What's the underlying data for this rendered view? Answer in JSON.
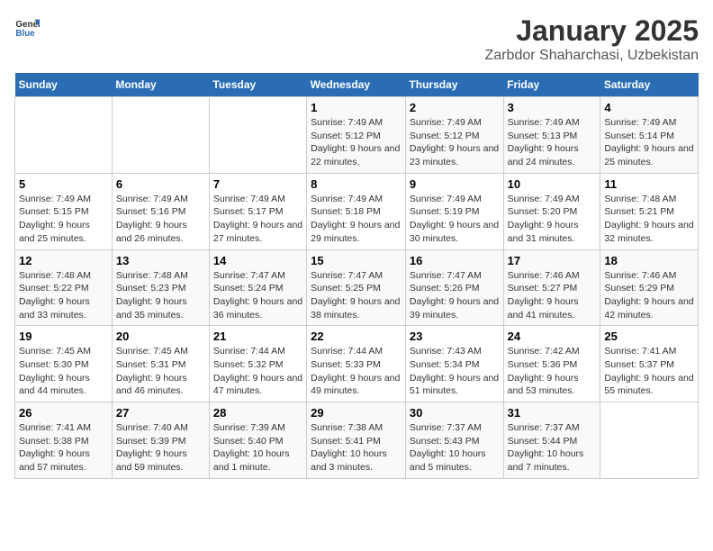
{
  "header": {
    "logo_general": "General",
    "logo_blue": "Blue",
    "title": "January 2025",
    "subtitle": "Zarbdor Shaharchasi, Uzbekistan"
  },
  "days_of_week": [
    "Sunday",
    "Monday",
    "Tuesday",
    "Wednesday",
    "Thursday",
    "Friday",
    "Saturday"
  ],
  "weeks": [
    [
      {
        "day": "",
        "info": ""
      },
      {
        "day": "",
        "info": ""
      },
      {
        "day": "",
        "info": ""
      },
      {
        "day": "1",
        "info": "Sunrise: 7:49 AM\nSunset: 5:12 PM\nDaylight: 9 hours and 22 minutes."
      },
      {
        "day": "2",
        "info": "Sunrise: 7:49 AM\nSunset: 5:12 PM\nDaylight: 9 hours and 23 minutes."
      },
      {
        "day": "3",
        "info": "Sunrise: 7:49 AM\nSunset: 5:13 PM\nDaylight: 9 hours and 24 minutes."
      },
      {
        "day": "4",
        "info": "Sunrise: 7:49 AM\nSunset: 5:14 PM\nDaylight: 9 hours and 25 minutes."
      }
    ],
    [
      {
        "day": "5",
        "info": "Sunrise: 7:49 AM\nSunset: 5:15 PM\nDaylight: 9 hours and 25 minutes."
      },
      {
        "day": "6",
        "info": "Sunrise: 7:49 AM\nSunset: 5:16 PM\nDaylight: 9 hours and 26 minutes."
      },
      {
        "day": "7",
        "info": "Sunrise: 7:49 AM\nSunset: 5:17 PM\nDaylight: 9 hours and 27 minutes."
      },
      {
        "day": "8",
        "info": "Sunrise: 7:49 AM\nSunset: 5:18 PM\nDaylight: 9 hours and 29 minutes."
      },
      {
        "day": "9",
        "info": "Sunrise: 7:49 AM\nSunset: 5:19 PM\nDaylight: 9 hours and 30 minutes."
      },
      {
        "day": "10",
        "info": "Sunrise: 7:49 AM\nSunset: 5:20 PM\nDaylight: 9 hours and 31 minutes."
      },
      {
        "day": "11",
        "info": "Sunrise: 7:48 AM\nSunset: 5:21 PM\nDaylight: 9 hours and 32 minutes."
      }
    ],
    [
      {
        "day": "12",
        "info": "Sunrise: 7:48 AM\nSunset: 5:22 PM\nDaylight: 9 hours and 33 minutes."
      },
      {
        "day": "13",
        "info": "Sunrise: 7:48 AM\nSunset: 5:23 PM\nDaylight: 9 hours and 35 minutes."
      },
      {
        "day": "14",
        "info": "Sunrise: 7:47 AM\nSunset: 5:24 PM\nDaylight: 9 hours and 36 minutes."
      },
      {
        "day": "15",
        "info": "Sunrise: 7:47 AM\nSunset: 5:25 PM\nDaylight: 9 hours and 38 minutes."
      },
      {
        "day": "16",
        "info": "Sunrise: 7:47 AM\nSunset: 5:26 PM\nDaylight: 9 hours and 39 minutes."
      },
      {
        "day": "17",
        "info": "Sunrise: 7:46 AM\nSunset: 5:27 PM\nDaylight: 9 hours and 41 minutes."
      },
      {
        "day": "18",
        "info": "Sunrise: 7:46 AM\nSunset: 5:29 PM\nDaylight: 9 hours and 42 minutes."
      }
    ],
    [
      {
        "day": "19",
        "info": "Sunrise: 7:45 AM\nSunset: 5:30 PM\nDaylight: 9 hours and 44 minutes."
      },
      {
        "day": "20",
        "info": "Sunrise: 7:45 AM\nSunset: 5:31 PM\nDaylight: 9 hours and 46 minutes."
      },
      {
        "day": "21",
        "info": "Sunrise: 7:44 AM\nSunset: 5:32 PM\nDaylight: 9 hours and 47 minutes."
      },
      {
        "day": "22",
        "info": "Sunrise: 7:44 AM\nSunset: 5:33 PM\nDaylight: 9 hours and 49 minutes."
      },
      {
        "day": "23",
        "info": "Sunrise: 7:43 AM\nSunset: 5:34 PM\nDaylight: 9 hours and 51 minutes."
      },
      {
        "day": "24",
        "info": "Sunrise: 7:42 AM\nSunset: 5:36 PM\nDaylight: 9 hours and 53 minutes."
      },
      {
        "day": "25",
        "info": "Sunrise: 7:41 AM\nSunset: 5:37 PM\nDaylight: 9 hours and 55 minutes."
      }
    ],
    [
      {
        "day": "26",
        "info": "Sunrise: 7:41 AM\nSunset: 5:38 PM\nDaylight: 9 hours and 57 minutes."
      },
      {
        "day": "27",
        "info": "Sunrise: 7:40 AM\nSunset: 5:39 PM\nDaylight: 9 hours and 59 minutes."
      },
      {
        "day": "28",
        "info": "Sunrise: 7:39 AM\nSunset: 5:40 PM\nDaylight: 10 hours and 1 minute."
      },
      {
        "day": "29",
        "info": "Sunrise: 7:38 AM\nSunset: 5:41 PM\nDaylight: 10 hours and 3 minutes."
      },
      {
        "day": "30",
        "info": "Sunrise: 7:37 AM\nSunset: 5:43 PM\nDaylight: 10 hours and 5 minutes."
      },
      {
        "day": "31",
        "info": "Sunrise: 7:37 AM\nSunset: 5:44 PM\nDaylight: 10 hours and 7 minutes."
      },
      {
        "day": "",
        "info": ""
      }
    ]
  ]
}
